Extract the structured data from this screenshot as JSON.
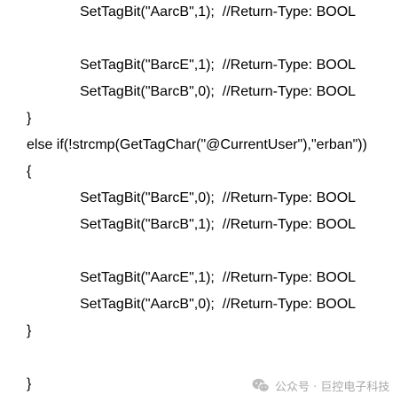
{
  "code": {
    "lines": [
      "SetTagBit(\"AarcB\",1);  //Return-Type: BOOL",
      "SetTagBit(\"BarcE\",1);  //Return-Type: BOOL",
      "SetTagBit(\"BarcB\",0);  //Return-Type: BOOL",
      "}",
      "else if(!strcmp(GetTagChar(\"@CurrentUser\"),\"erban\"))",
      "{",
      "SetTagBit(\"BarcE\",0);  //Return-Type: BOOL",
      "SetTagBit(\"BarcB\",1);  //Return-Type: BOOL",
      "SetTagBit(\"AarcE\",1);  //Return-Type: BOOL",
      "SetTagBit(\"AarcB\",0);  //Return-Type: BOOL",
      "}",
      "}"
    ]
  },
  "watermark": {
    "text": "公众号 · 巨控电子科技",
    "icon": "wechat-icon"
  }
}
